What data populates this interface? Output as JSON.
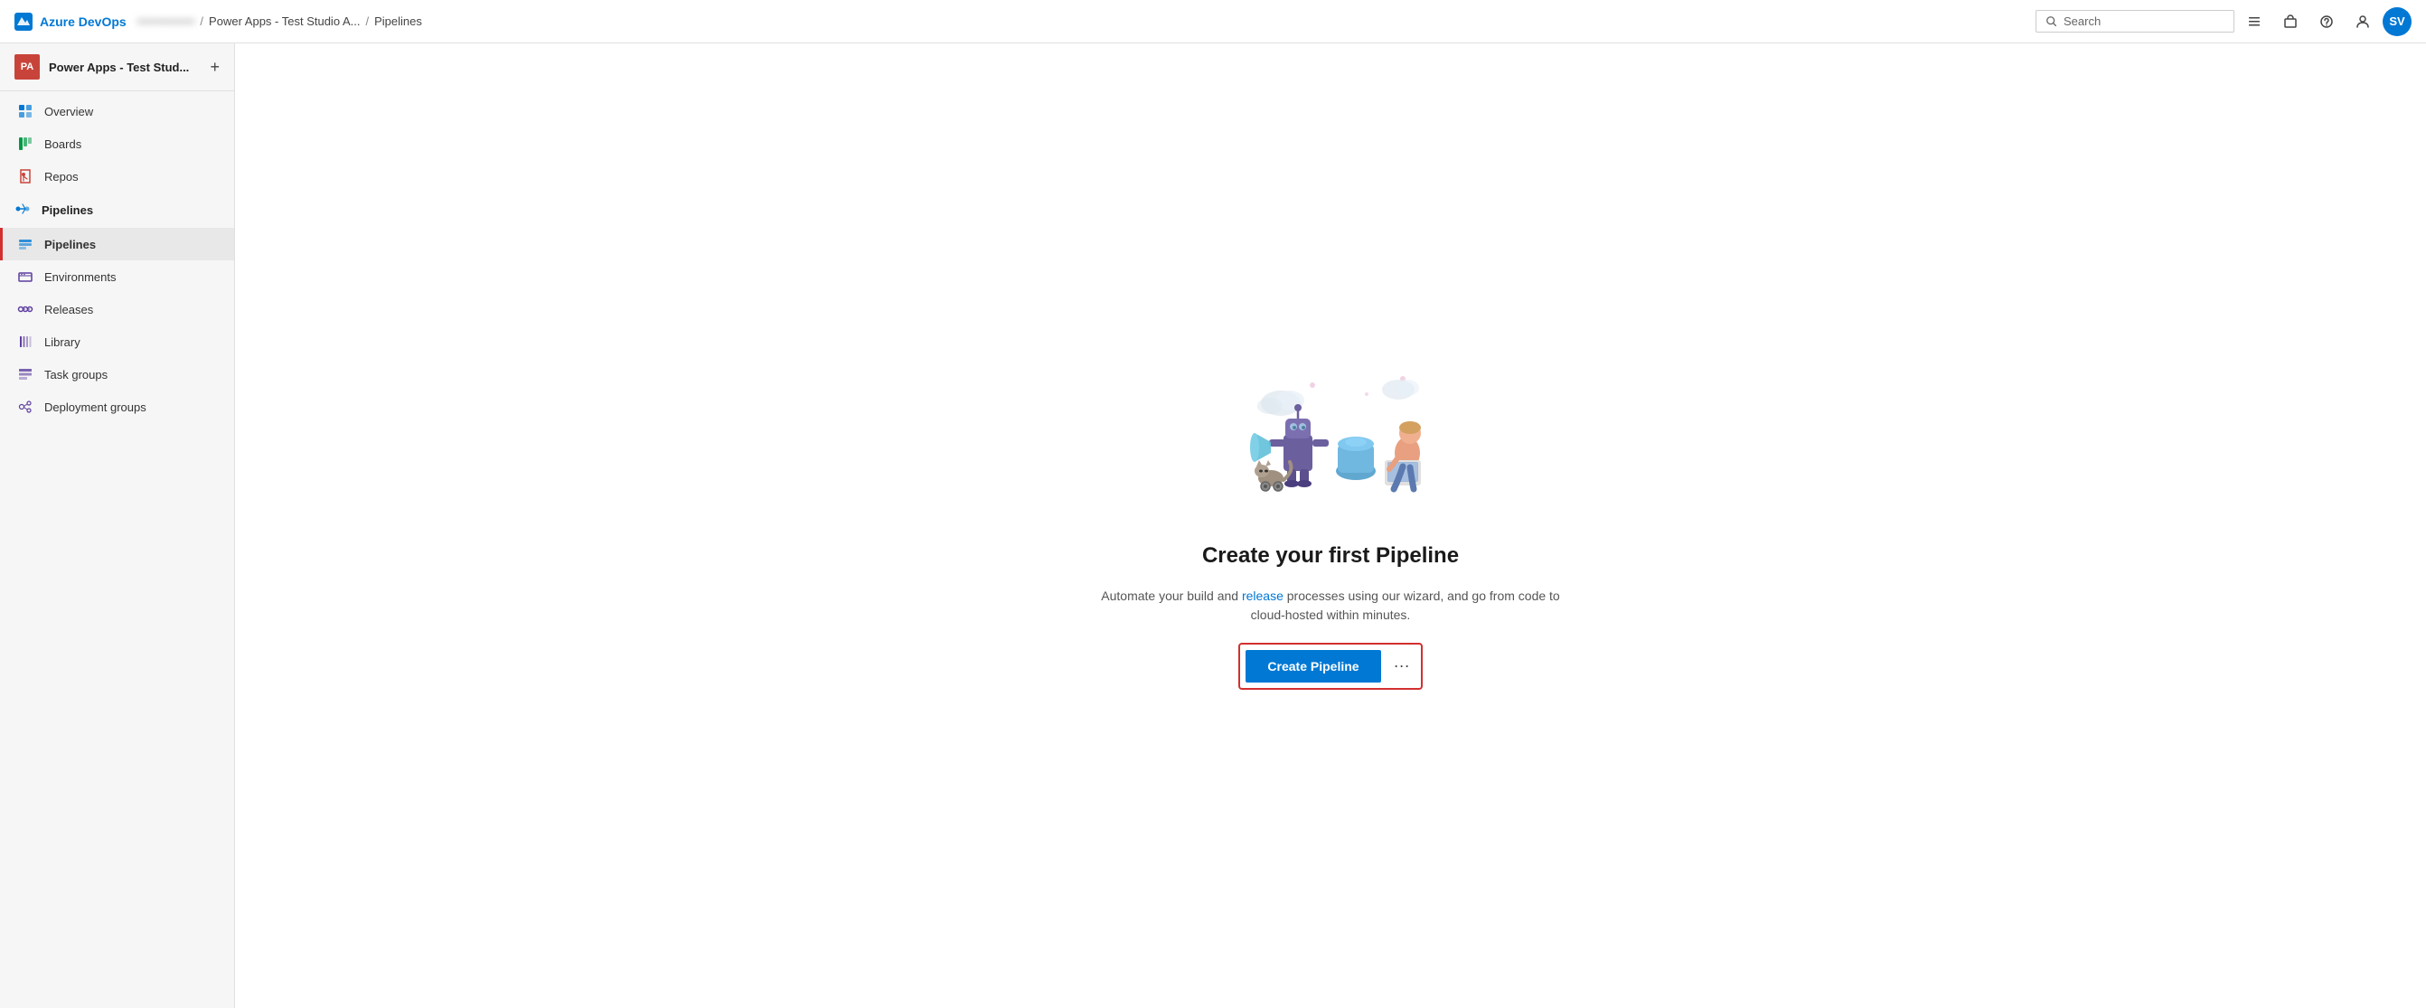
{
  "app": {
    "name": "Azure DevOps",
    "logo_label": "Azure DevOps Logo"
  },
  "topbar": {
    "breadcrumb": [
      {
        "id": "org",
        "label": "••••••••••••••",
        "blurred": true
      },
      {
        "id": "sep1",
        "label": "/"
      },
      {
        "id": "project",
        "label": "Power Apps - Test Studio A..."
      },
      {
        "id": "sep2",
        "label": "/"
      },
      {
        "id": "page",
        "label": "Pipelines"
      }
    ],
    "search_placeholder": "Search",
    "avatar_initials": "SV"
  },
  "sidebar": {
    "project_avatar": "PA",
    "project_name": "Power Apps - Test Stud...",
    "nav_items": [
      {
        "id": "overview",
        "label": "Overview",
        "icon": "overview"
      },
      {
        "id": "boards",
        "label": "Boards",
        "icon": "boards"
      },
      {
        "id": "repos",
        "label": "Repos",
        "icon": "repos"
      },
      {
        "id": "pipelines-group",
        "label": "Pipelines",
        "icon": "pipelines",
        "is_group": true
      },
      {
        "id": "pipelines",
        "label": "Pipelines",
        "icon": "pipelines-sub",
        "selected": true
      },
      {
        "id": "environments",
        "label": "Environments",
        "icon": "environments"
      },
      {
        "id": "releases",
        "label": "Releases",
        "icon": "releases"
      },
      {
        "id": "library",
        "label": "Library",
        "icon": "library"
      },
      {
        "id": "taskgroups",
        "label": "Task groups",
        "icon": "taskgroups"
      },
      {
        "id": "deploymentgroups",
        "label": "Deployment groups",
        "icon": "deploygroups"
      }
    ]
  },
  "content": {
    "title": "Create your first Pipeline",
    "description_part1": "Automate your build and",
    "description_link1": "release",
    "description_part2": "processes using our wizard, and go from code to cloud-hosted within minutes.",
    "description_build": "build",
    "create_button_label": "Create Pipeline",
    "more_options_label": "···"
  }
}
